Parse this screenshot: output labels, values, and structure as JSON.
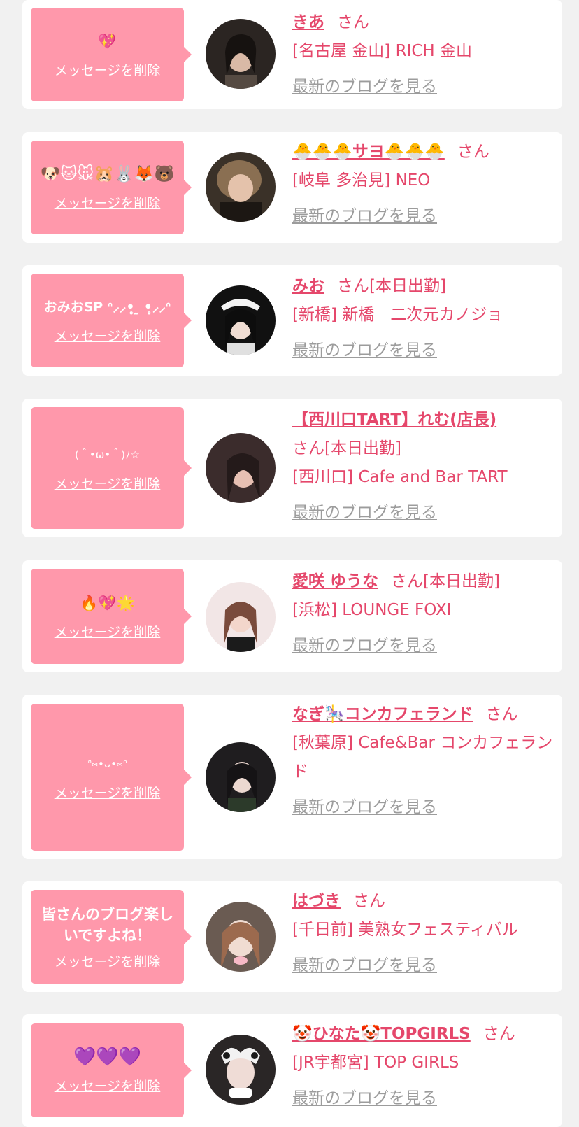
{
  "common": {
    "delete_label": "メッセージを削除",
    "blog_label": "最新のブログを見る",
    "san_suffix": "さん"
  },
  "colors": {
    "page_bg": "#f1f1f1",
    "card_bg": "#ffffff",
    "bubble_bg": "#ff98ab",
    "accent": "#e5476b",
    "link_gray": "#9c9c9c"
  },
  "entries": [
    {
      "message": "💖",
      "name": "きあ",
      "suffix": "さん",
      "shop": "[名古屋 金山] RICH 金山",
      "avatar_icon": "girl-photo-avatar",
      "avatar_colors": [
        "#2b2522",
        "#8a7a68"
      ]
    },
    {
      "message": "🐶🐱🐭🐹🐰🦊🐻",
      "name": "🐣🐣🐣サヨ🐣🐣🐣",
      "suffix": "さん",
      "shop": "[岐阜 多治見] NEO",
      "avatar_icon": "girl-photo-avatar",
      "avatar_colors": [
        "#3a3128",
        "#b0966e"
      ]
    },
    {
      "message": "おみおSP ᐢ⸝⸝•̥ ̫ •̥⸝⸝ᐢ",
      "name": "みお",
      "suffix": "さん[本日出勤]",
      "shop": "[新橋] 新橋　二次元カノジョ",
      "avatar_icon": "girl-photo-avatar",
      "avatar_colors": [
        "#111111",
        "#d9d3d6"
      ]
    },
    {
      "message": "(＾•ω•＾)ﾉ☆",
      "name": "【西川口TART】れむ(店長)",
      "suffix": "さん[本日出勤]",
      "shop": "[西川口] Cafe and Bar TART",
      "avatar_icon": "girl-photo-avatar",
      "avatar_colors": [
        "#3b2c2c",
        "#d5a89b"
      ]
    },
    {
      "message": "🔥💖🌟",
      "name": "愛咲 ゆうな",
      "suffix": "さん[本日出勤]",
      "shop": "[浜松] LOUNGE FOXI",
      "avatar_icon": "girl-photo-avatar",
      "avatar_colors": [
        "#f2e6e6",
        "#a7796a"
      ]
    },
    {
      "message": "ᐢ⑅•ᴗ•⑅ᐢ",
      "name": "なぎ🎠コンカフェランド",
      "suffix": "さん",
      "shop": "[秋葉原] Cafe&Bar コンカフェランド",
      "avatar_icon": "girl-photo-avatar",
      "avatar_colors": [
        "#1f1d1f",
        "#cfc2bc"
      ]
    },
    {
      "message": "皆さんのブログ楽しいですよね！",
      "name": "はづき",
      "suffix": "さん",
      "shop": "[千日前] 美熟女フェスティバル",
      "avatar_icon": "girl-photo-avatar",
      "avatar_colors": [
        "#6a5b52",
        "#e9d3c8"
      ]
    },
    {
      "message": "💜💜💜",
      "name": "🤡ひなた🤡TOPGIRLS",
      "suffix": "さん",
      "shop": "[JR宇都宮] TOP GIRLS",
      "avatar_icon": "girl-photo-avatar",
      "avatar_colors": [
        "#2a2626",
        "#e6e0dd"
      ]
    }
  ]
}
